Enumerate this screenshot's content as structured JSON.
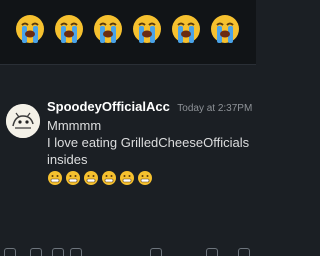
{
  "top_emojis": [
    "loudly-crying-face",
    "loudly-crying-face",
    "loudly-crying-face",
    "loudly-crying-face",
    "loudly-crying-face",
    "loudly-crying-face"
  ],
  "message": {
    "username": "SpoodeyOfficialAcc",
    "timestamp": "Today at 2:37PM",
    "lines": [
      "Mmmmm",
      "I love eating GrilledCheeseOfficials",
      "insides"
    ],
    "reaction_emojis": [
      "grimacing-face",
      "grimacing-face",
      "grimacing-face",
      "grimacing-face",
      "grimacing-face",
      "grimacing-face"
    ]
  },
  "colors": {
    "background": "#1b1f24",
    "top_band": "#111417",
    "username": "#ffffff",
    "text": "#dcddde",
    "timestamp": "#8e9297",
    "emoji_yellow": "#f6c12f",
    "tear_blue": "#4aa3e8"
  }
}
